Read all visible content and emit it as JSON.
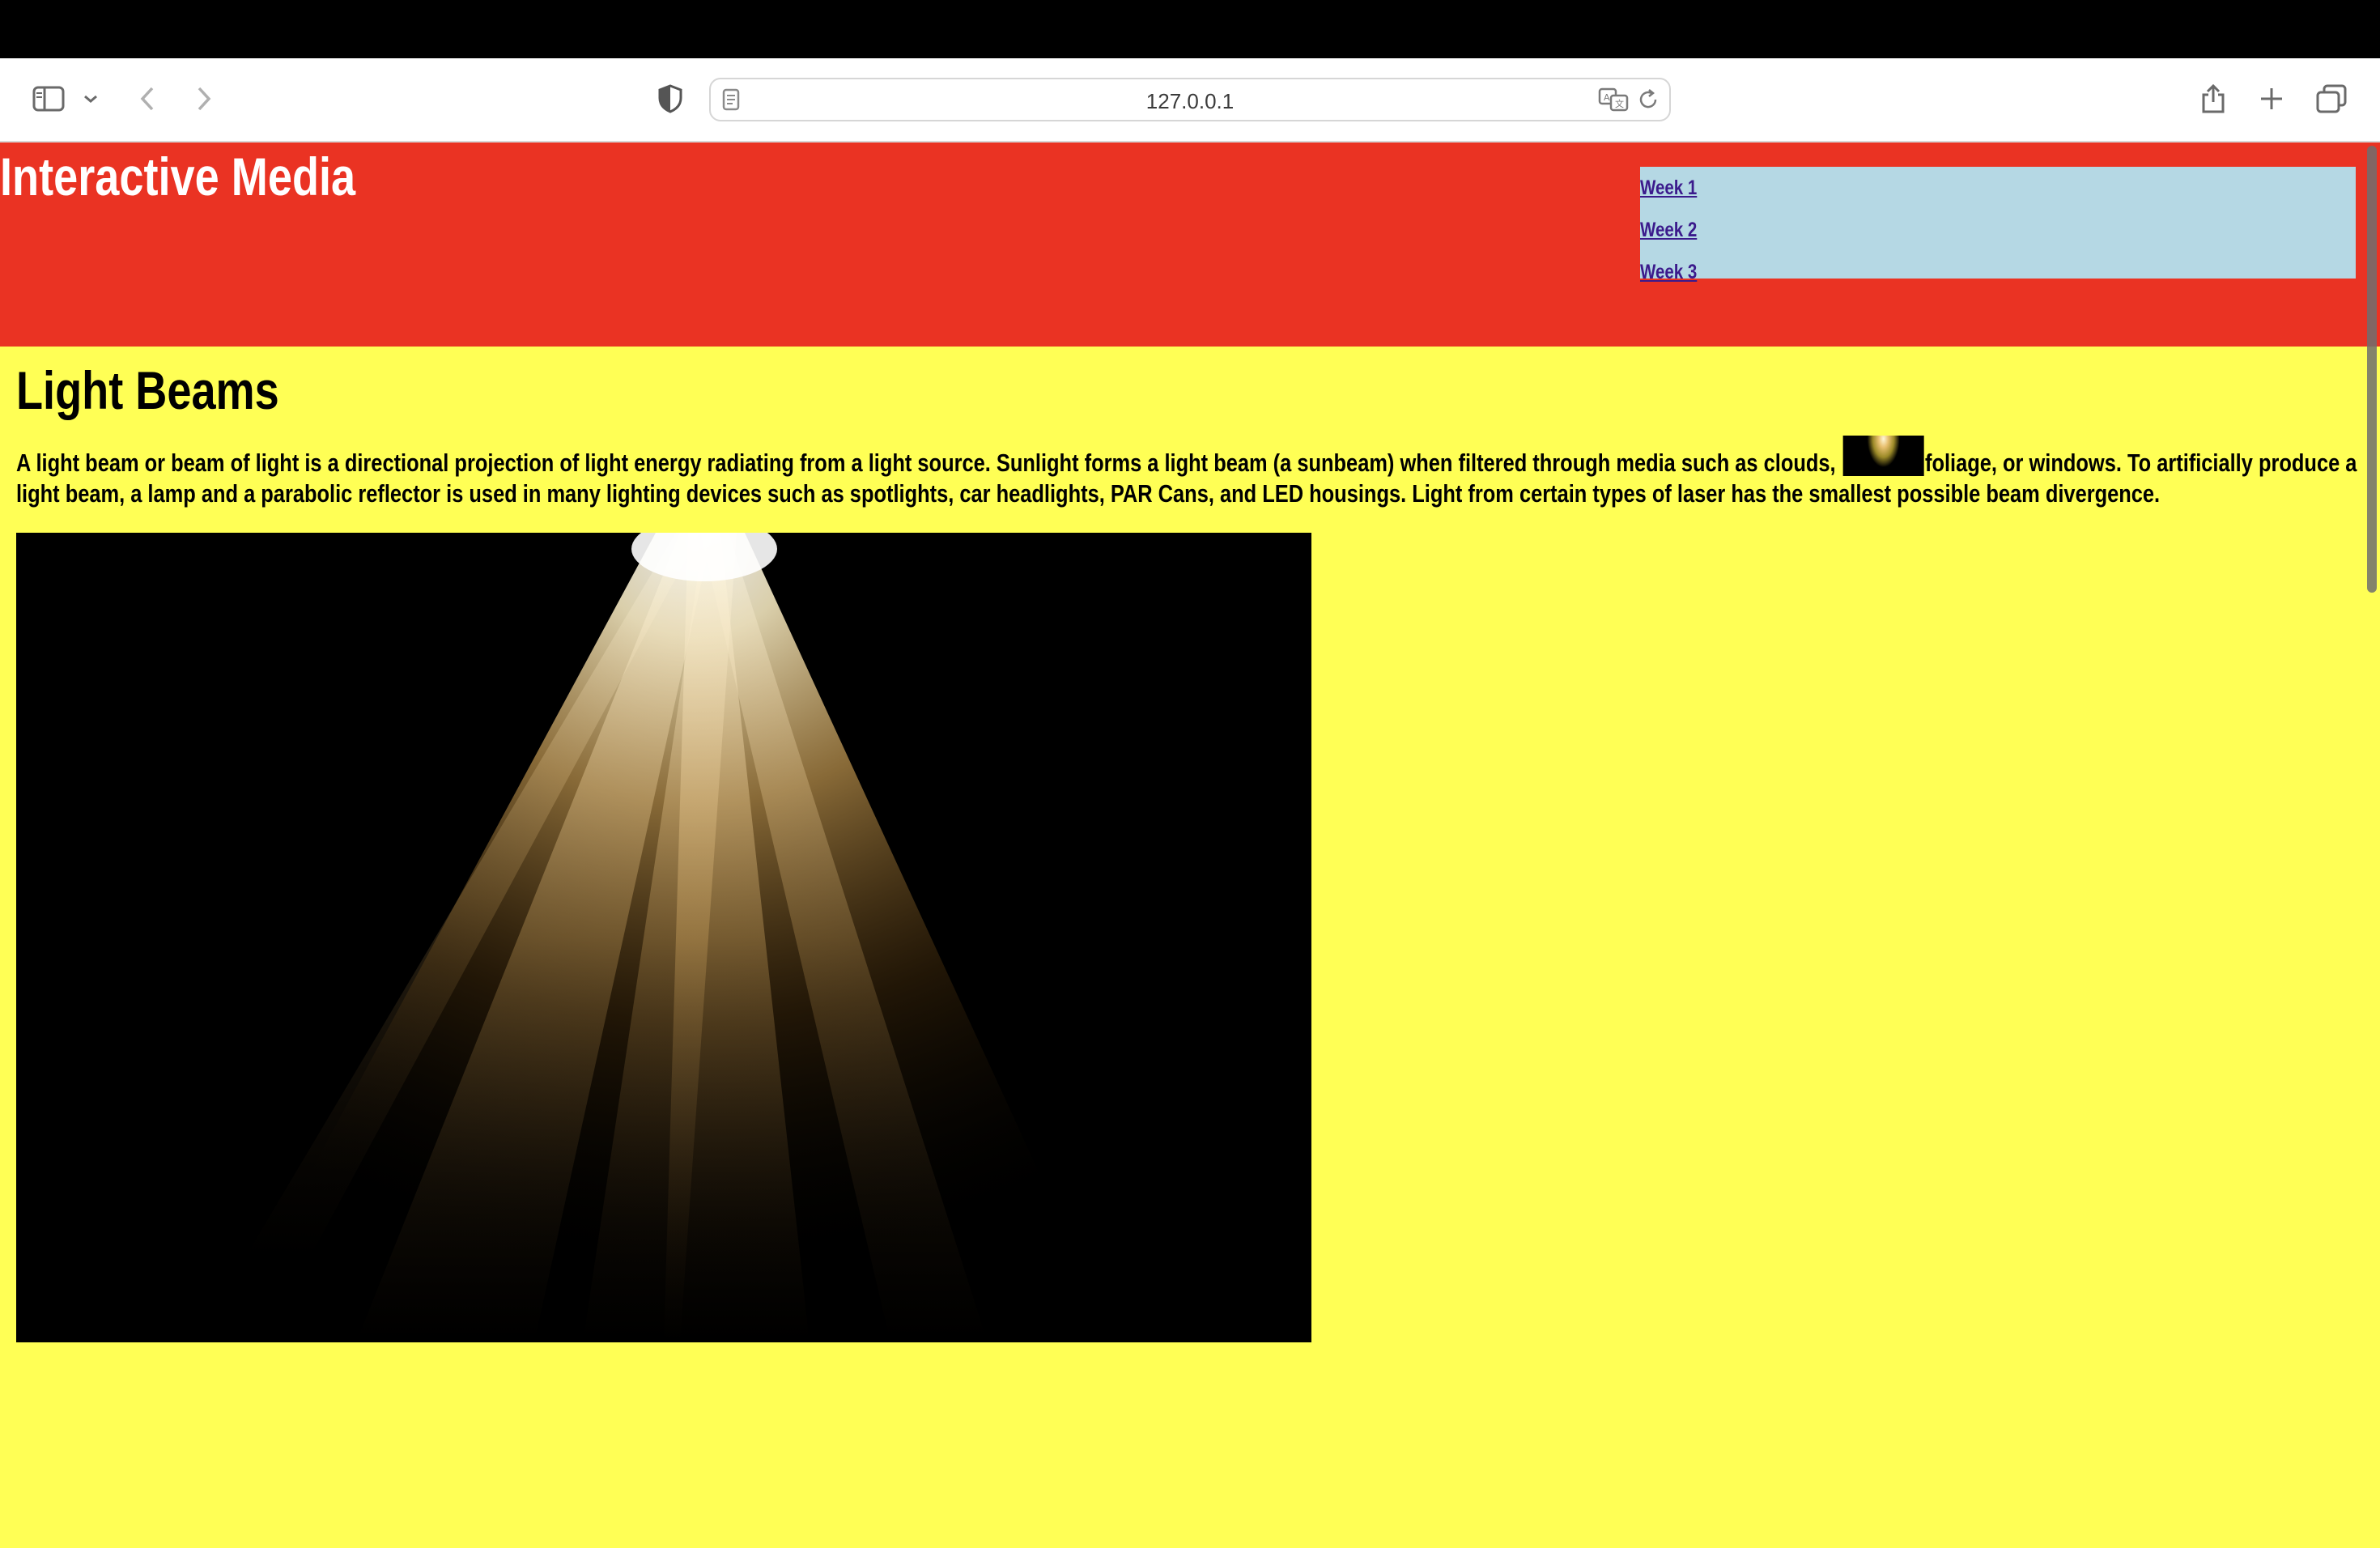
{
  "browser": {
    "address": "127.0.0.1",
    "icons": {
      "sidebar": "sidebar-icon",
      "sidebar_menu": "chevron-down-icon",
      "back": "chevron-left-icon",
      "forward": "chevron-right-icon",
      "privacy": "shield-icon",
      "page": "page-icon",
      "translate": "translate-icon",
      "reload": "reload-icon",
      "share": "share-icon",
      "new_tab": "plus-icon",
      "tabs": "tab-overview-icon"
    }
  },
  "site": {
    "title": "Interactive Media",
    "nav": [
      "Week 1",
      "Week 2",
      "Week 3"
    ],
    "colors": {
      "header_bg": "#ea3323",
      "nav_bg": "#b5d8e4",
      "body_bg": "#ffff55",
      "link": "#3b1a8c"
    }
  },
  "main": {
    "heading": "Light Beams",
    "intro_before": "A light beam or beam of light is a directional projection of light energy radiating from a light source. Sunlight forms a light beam (a sunbeam) when filtered through media such as clouds, ",
    "intro_after": "foliage, or windows. To artificially produce a light beam, a lamp and a parabolic reflector is used in many lighting devices such as spotlights, car headlights, PAR Cans, and LED housings. Light from certain types of laser has the smallest possible beam divergence.",
    "inline_image": "light-beam-thumbnail",
    "hero_image": "light-beam-image"
  }
}
